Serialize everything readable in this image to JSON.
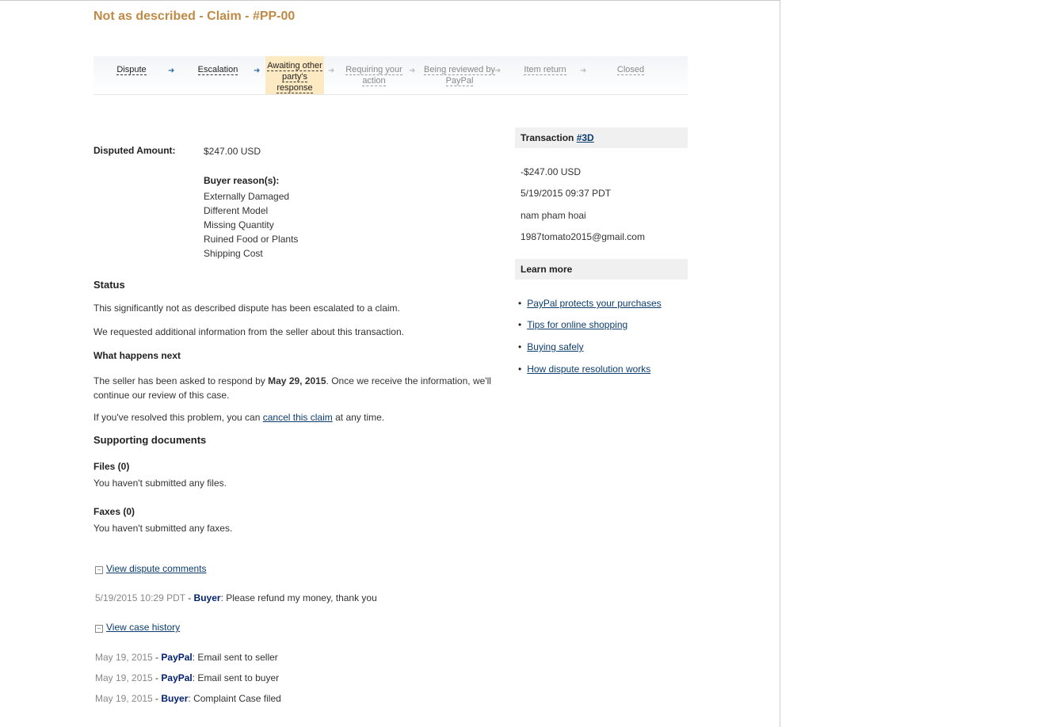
{
  "title": "Not as described - Claim - #PP-00",
  "steps": [
    {
      "label": "Dispute",
      "state": "done"
    },
    {
      "label": "Escalation",
      "state": "done"
    },
    {
      "label": "Awaiting other party's response",
      "state": "current"
    },
    {
      "label": "Requiring your action",
      "state": "todo"
    },
    {
      "label": "Being reviewed by PayPal",
      "state": "todo"
    },
    {
      "label": "Item return",
      "state": "todo"
    },
    {
      "label": "Closed",
      "state": "todo"
    }
  ],
  "colors": {
    "title": "#c08a45",
    "current_step": "#fde9c2",
    "link": "#0b3d6f",
    "party": "#001f6f"
  },
  "disputed": {
    "label": "Disputed Amount:",
    "value": "$247.00 USD",
    "reasons_label": "Buyer reason(s):",
    "reasons": [
      "Externally Damaged",
      "Different Model",
      "Missing Quantity",
      "Ruined Food or Plants",
      "Shipping Cost"
    ]
  },
  "status": {
    "heading": "Status",
    "line1": "This significantly not as described dispute has been escalated to a claim.",
    "line2": "We requested additional information from the seller about this transaction.",
    "next_heading": "What happens next",
    "next_pre": "The seller has been asked to respond by ",
    "next_date": "May 29, 2015",
    "next_post": ". Once we receive the information, we'll",
    "next_line2": "continue our review of this case.",
    "cancel_pre": "If you've resolved this problem, you can ",
    "cancel_link": "cancel this claim",
    "cancel_post": " at any time."
  },
  "docs": {
    "heading": "Supporting documents",
    "files_label": "Files (0)",
    "files_text": "You haven't submitted any files.",
    "faxes_label": "Faxes (0)",
    "faxes_text": "You haven't submitted any faxes."
  },
  "comments": {
    "toggle": "View dispute comments",
    "items": [
      {
        "date": "5/19/2015 10:29 PDT",
        "who": "Buyer",
        "text": ": Please refund my money, thank you"
      }
    ]
  },
  "history": {
    "toggle": "View case history",
    "items": [
      {
        "date": "May 19, 2015",
        "who": "PayPal",
        "text": ": Email sent to seller"
      },
      {
        "date": "May 19, 2015",
        "who": "PayPal",
        "text": ": Email sent to buyer"
      },
      {
        "date": "May 19, 2015",
        "who": "Buyer",
        "text": ": Complaint Case filed"
      }
    ]
  },
  "transaction": {
    "label": "Transaction ",
    "id": "#3D",
    "amount": "-$247.00 USD",
    "date": "5/19/2015 09:37 PDT",
    "name": "nam pham hoai",
    "email": "1987tomato2015@gmail.com"
  },
  "learn": {
    "heading": "Learn more",
    "links": [
      "PayPal protects your purchases",
      "Tips for online shopping",
      "Buying safely",
      "How dispute resolution works"
    ]
  }
}
